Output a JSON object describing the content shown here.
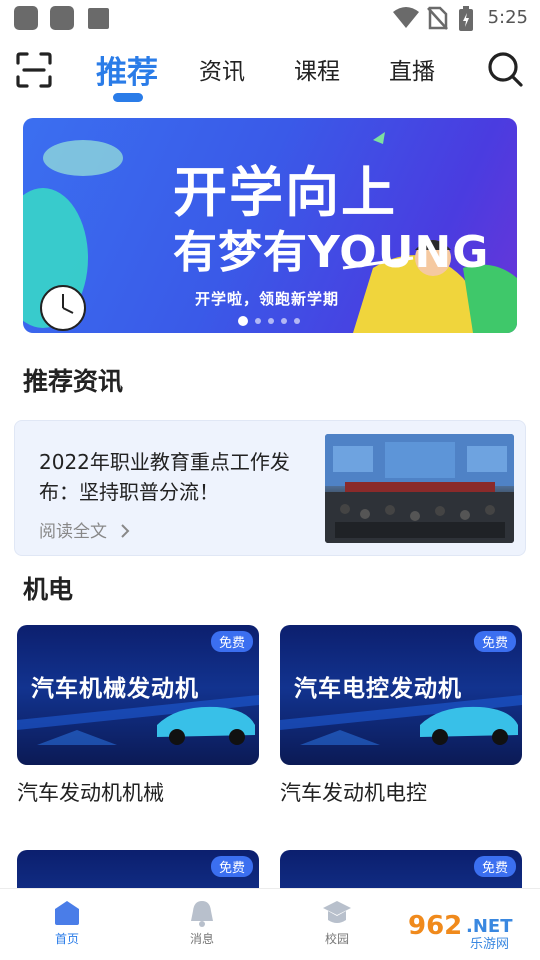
{
  "status_bar": {
    "time": "5:25"
  },
  "top_nav": {
    "tabs": [
      {
        "label": "推荐",
        "active": true
      },
      {
        "label": "资讯",
        "active": false
      },
      {
        "label": "课程",
        "active": false
      },
      {
        "label": "直播",
        "active": false
      }
    ],
    "scan_icon": "scan-icon",
    "search_icon": "search-icon",
    "accent": "#2a7ce8"
  },
  "banner": {
    "title_line1": "开学向上",
    "title_line2": "有梦有YOUNG",
    "subtitle": "开学啦，领跑新学期",
    "dots": 5,
    "active_dot": 0
  },
  "news_section": {
    "title": "推荐资讯",
    "item": {
      "title": "2022年职业教育重点工作发布：坚持职普分流！",
      "read_more": "阅读全文"
    }
  },
  "course_section": {
    "title": "机电",
    "courses": [
      {
        "thumb_text": "汽车机械发动机",
        "badge": "免费",
        "name": "汽车发动机机械"
      },
      {
        "thumb_text": "汽车电控发动机",
        "badge": "免费",
        "name": "汽车发动机电控"
      },
      {
        "thumb_text": "",
        "badge": "免费",
        "name": ""
      },
      {
        "thumb_text": "",
        "badge": "免费",
        "name": ""
      }
    ]
  },
  "bottom_nav": {
    "items": [
      {
        "label": "首页",
        "icon": "home-icon",
        "active": true
      },
      {
        "label": "消息",
        "icon": "bell-icon",
        "active": false
      },
      {
        "label": "校园",
        "icon": "graduation-cap-icon",
        "active": false
      }
    ]
  },
  "watermark": {
    "text1": "962",
    "text2": ".NET",
    "text3": "乐游网"
  }
}
